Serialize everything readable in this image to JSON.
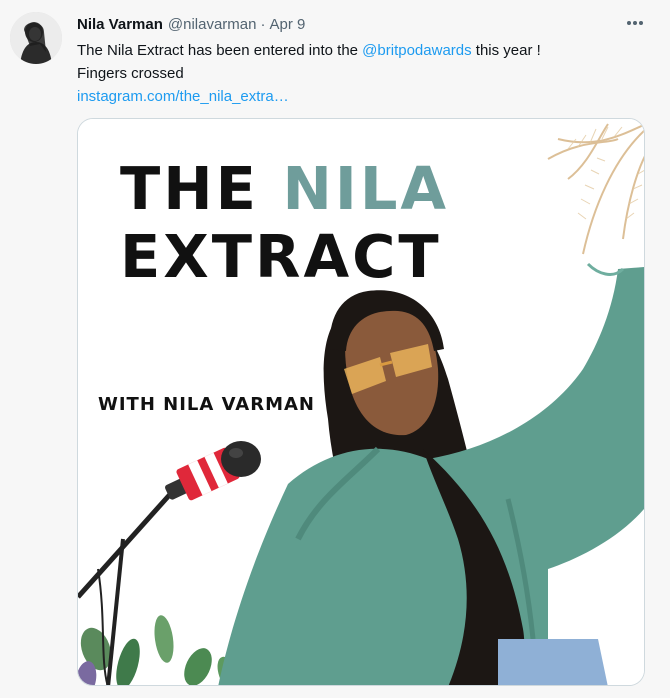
{
  "tweet": {
    "author_name": "Nila Varman",
    "author_handle": "@nilavarman",
    "separator": "·",
    "date": "Apr 9",
    "more_icon": "more-horizontal-icon",
    "text": {
      "line1_before": "The Nila Extract has been entered into the ",
      "mention": "@britpodawards",
      "line1_after": " this year !",
      "line2": "Fingers crossed",
      "link": "instagram.com/the_nila_extra…"
    },
    "media": {
      "title_word1": "THE",
      "title_word2": "NILA",
      "title_line2": "EXTRACT",
      "subtitle": "WITH NILA VARMAN",
      "colors": {
        "title_dark": "#111111",
        "title_teal": "#6f9d9b",
        "sweater": "#5f9e8f",
        "mic_red": "#e0283a"
      }
    }
  }
}
